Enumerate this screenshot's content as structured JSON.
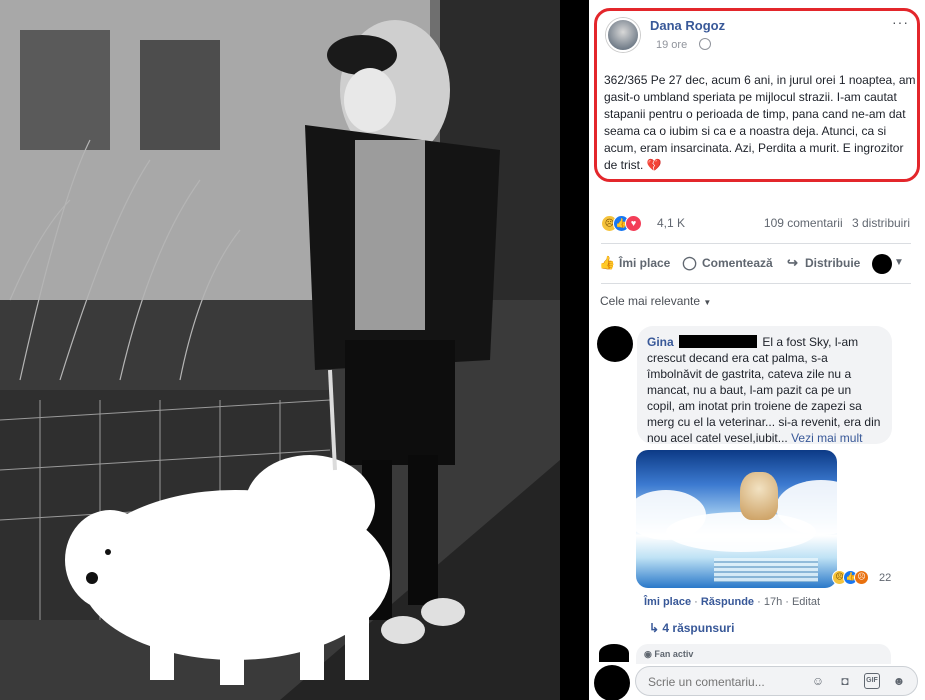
{
  "post": {
    "author": "Dana Rogoz",
    "time": "19 ore",
    "more_icon": "···",
    "text": "362/365 Pe 27 dec, acum 6 ani, in jurul orei 1 noaptea, am gasit-o umbland speriata pe mijlocul strazii. I-am cautat stapanii pentru o perioada de timp, pana cand ne-am dat seama ca o iubim si ca e a noastra deja. Atunci, ca si acum, eram insarcinata. Azi, Perdita a murit. E ingrozitor de trist.",
    "heart_emoji": "💔",
    "reaction_count": "4,1 K",
    "comments_count": "109 comentarii",
    "shares_count": "3 distribuiri"
  },
  "actions": {
    "like": "Îmi place",
    "comment": "Comentează",
    "share": "Distribuie"
  },
  "sort_label": "Cele mai relevante",
  "comment": {
    "name": "Gina",
    "text": "El a fost Sky, l-am crescut decand era cat palma, s-a îmbolnăvit de gastrita, cateva zile nu a mancat, nu a baut, l-am pazit ca pe un copil, am inotat prin troiene de zapezi sa merg cu el la veterinar... si-a revenit, era din nou acel catel vesel,iubit...",
    "see_more": "Vezi mai mult",
    "image_reaction_count": "22",
    "like": "Îmi place",
    "reply": "Răspunde",
    "time": "17h",
    "edited": "Editat",
    "replies": "4 răspunsuri"
  },
  "fan_badge": "Fan activ",
  "input": {
    "placeholder": "Scrie un comentariu..."
  },
  "icons": [
    "globe-icon",
    "more-icon",
    "like-icon",
    "comment-icon",
    "share-icon",
    "emoji-icon",
    "camera-icon",
    "gif-icon",
    "sticker-icon"
  ],
  "colors": {
    "highlight": "#e3262b",
    "link": "#385898"
  }
}
